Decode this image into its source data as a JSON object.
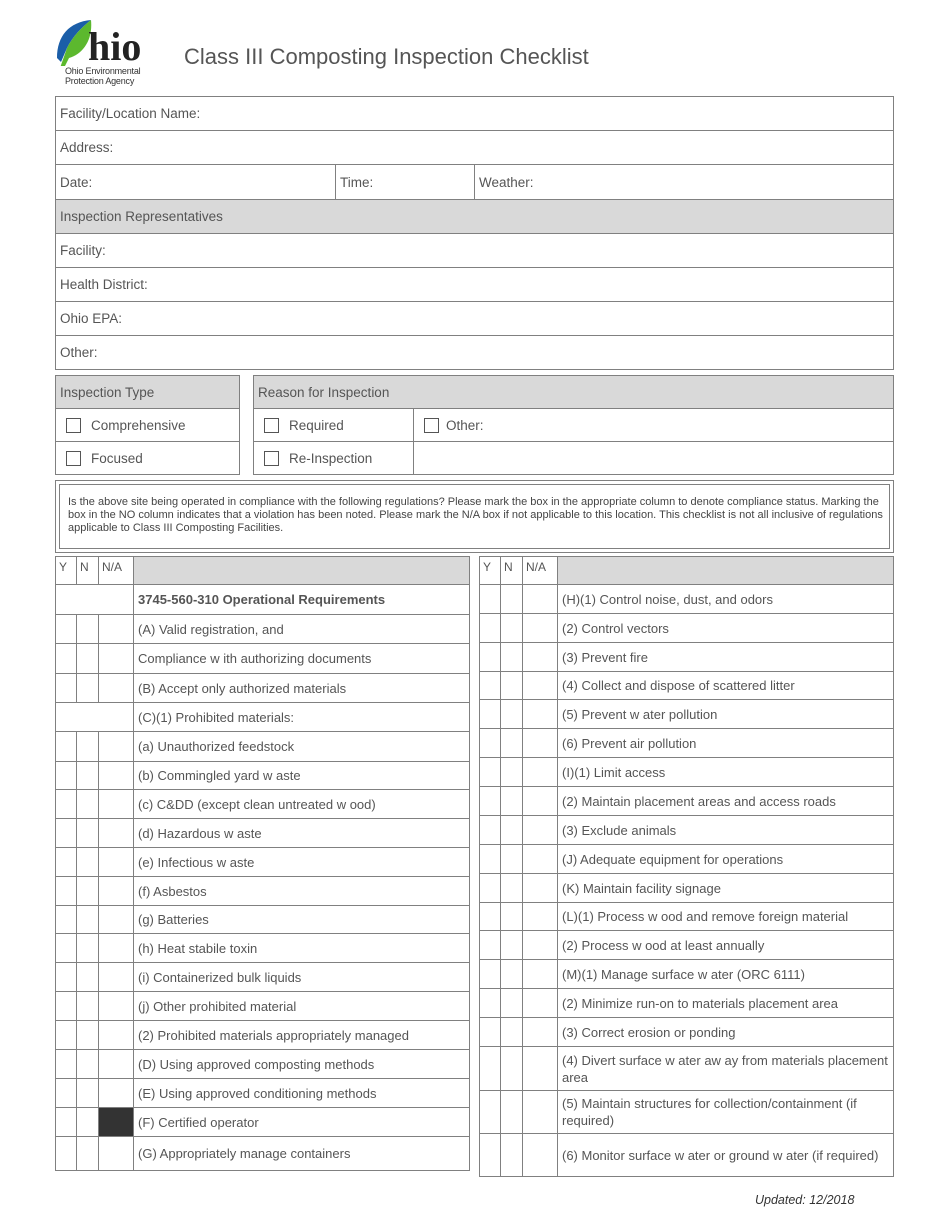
{
  "header": {
    "logo": {
      "wordmark": "hio",
      "agency_line1": "Ohio Environmental",
      "agency_line2": "Protection Agency",
      "leaf_colors": {
        "blue": "#1b5ea8",
        "green": "#5cb82e"
      }
    },
    "title": "Class III Composting Inspection Checklist"
  },
  "site_info": {
    "facility_location_label": "Facility/Location Name:",
    "address_label": "Address:",
    "date_label": "Date:",
    "time_label": "Time:",
    "weather_label": "Weather:",
    "representatives_header": "Inspection Representatives",
    "facility_label": "Facility:",
    "health_district_label": "Health District:",
    "ohio_epa_label": "Ohio EPA:",
    "other_label": "Other:"
  },
  "inspection_type": {
    "header": "Inspection Type",
    "options": [
      {
        "label": "Comprehensive",
        "checked": false
      },
      {
        "label": "Focused",
        "checked": false
      }
    ]
  },
  "reason": {
    "header": "Reason for Inspection",
    "options": [
      {
        "label": "Required",
        "checked": false
      },
      {
        "label": "Other:",
        "checked": false
      },
      {
        "label": "Re-Inspection",
        "checked": false
      }
    ]
  },
  "notice": "Is the above site being operated  in compliance with the following regulations? Please mark the box in the appropriate column to denote compliance status. Marking the box in the NO column indicates that a violation has been noted. Please mark the N/A box if not applicable  to this location. This checklist is not all inclusive of regulations applicable to Class III Composting Facilities.",
  "columns": {
    "yes": "Y",
    "no": "N",
    "na": "N/A"
  },
  "left_items": [
    {
      "text": "3745-560-310 Operational Requirements",
      "type": "section"
    },
    {
      "text": "(A) Valid registration, and"
    },
    {
      "text": "Compliance w ith authorizing documents"
    },
    {
      "text": "(B) Accept only authorized materials"
    },
    {
      "text": "(C)(1) Prohibited materials:",
      "type": "section"
    },
    {
      "text": "(a) Unauthorized feedstock"
    },
    {
      "text": "(b) Commingled yard w aste"
    },
    {
      "text": "(c) C&DD (except clean untreated w ood)"
    },
    {
      "text": "(d) Hazardous w aste"
    },
    {
      "text": "(e) Infectious w aste"
    },
    {
      "text": "(f) Asbestos"
    },
    {
      "text": "(g) Batteries"
    },
    {
      "text": "(h) Heat stabile toxin"
    },
    {
      "text": "(i) Containerized bulk liquids"
    },
    {
      "text": "(j) Other prohibited material"
    },
    {
      "text": "(2) Prohibited materials appropriately managed"
    },
    {
      "text": "(D) Using approved composting methods"
    },
    {
      "text": "(E) Using approved conditioning methods"
    },
    {
      "text": "(F) Certified operator",
      "na_filled": true
    },
    {
      "text": "(G) Appropriately manage containers"
    }
  ],
  "right_items": [
    {
      "text": "(H)(1) Control noise, dust, and odors"
    },
    {
      "text": "(2) Control vectors"
    },
    {
      "text": "(3) Prevent fire"
    },
    {
      "text": "(4) Collect and dispose of scattered litter"
    },
    {
      "text": "(5) Prevent w ater pollution"
    },
    {
      "text": "(6) Prevent air pollution"
    },
    {
      "text": "(I)(1) Limit access"
    },
    {
      "text": "(2) Maintain placement areas and access roads"
    },
    {
      "text": "(3) Exclude animals"
    },
    {
      "text": "(J) Adequate equipment for operations"
    },
    {
      "text": "(K) Maintain facility signage"
    },
    {
      "text": "(L)(1) Process w ood and remove foreign material"
    },
    {
      "text": "(2) Process w ood at least annually"
    },
    {
      "text": "(M)(1) Manage surface w ater (ORC 6111)"
    },
    {
      "text": "(2) Minimize run-on to  materials placement area"
    },
    {
      "text": "(3) Correct erosion or ponding"
    },
    {
      "text": "(4) Divert surface w ater aw ay from materials placement area"
    },
    {
      "text": "(5) Maintain structures for collection/containment (if required)"
    },
    {
      "text": "(6) Monitor surface w ater or ground w ater (if required)"
    }
  ],
  "footer": {
    "updated": "Updated: 12/2018"
  }
}
